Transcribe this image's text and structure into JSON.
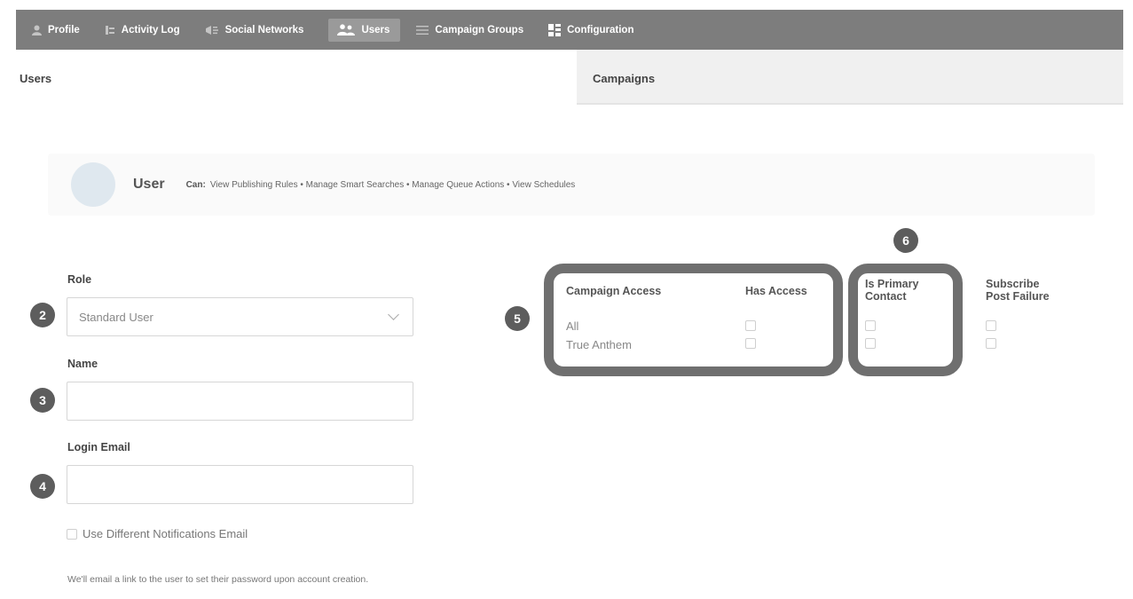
{
  "nav": {
    "items": [
      {
        "label": "Profile",
        "icon": "person-icon"
      },
      {
        "label": "Activity Log",
        "icon": "log-icon"
      },
      {
        "label": "Social Networks",
        "icon": "megaphone-icon"
      },
      {
        "label": "Users",
        "icon": "users-icon",
        "active": true
      },
      {
        "label": "Campaign Groups",
        "icon": "list-icon"
      },
      {
        "label": "Configuration",
        "icon": "grid-icon"
      }
    ]
  },
  "tabs": {
    "users": "Users",
    "campaigns": "Campaigns"
  },
  "role_card": {
    "title": "User",
    "can_label": "Can:",
    "can_list": "View Publishing Rules • Manage Smart Searches • Manage Queue Actions • View Schedules"
  },
  "form": {
    "role_label": "Role",
    "role_value": "Standard User",
    "name_label": "Name",
    "name_value": "",
    "email_label": "Login Email",
    "email_value": "",
    "diff_email_label": "Use Different Notifications Email",
    "note": "We'll email a link to the user to set their password upon account creation."
  },
  "badges": {
    "b2": "2",
    "b3": "3",
    "b4": "4",
    "b5": "5",
    "b6": "6"
  },
  "campaign_table": {
    "col_access": "Campaign Access",
    "col_has_access": "Has Access",
    "col_primary_line1": "Is Primary",
    "col_primary_line2": "Contact",
    "col_subscribe_line1": "Subscribe",
    "col_subscribe_line2": "Post Failure",
    "rows": [
      {
        "name": "All"
      },
      {
        "name": "True Anthem"
      }
    ]
  },
  "colors": {
    "nav_bg": "#7d7d7d",
    "highlight": "#6f6f6f",
    "badge": "#5d5d5d",
    "avatar": "#dfe8ef"
  }
}
